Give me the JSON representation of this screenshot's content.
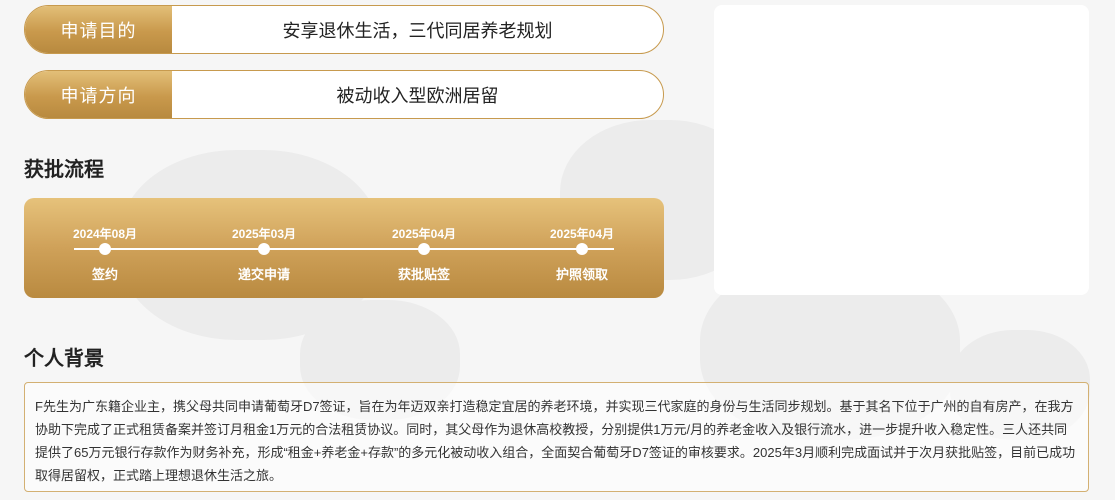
{
  "application": {
    "purpose_label": "申请目的",
    "purpose_value": "安享退休生活，三代同居养老规划",
    "direction_label": "申请方向",
    "direction_value": "被动收入型欧洲居留"
  },
  "process": {
    "title": "获批流程",
    "steps": [
      {
        "date": "2024年08月",
        "name": "签约"
      },
      {
        "date": "2025年03月",
        "name": "递交申请"
      },
      {
        "date": "2025年04月",
        "name": "获批贴签"
      },
      {
        "date": "2025年04月",
        "name": "护照领取"
      }
    ]
  },
  "background": {
    "title": "个人背景",
    "text": "F先生为广东籍企业主，携父母共同申请葡萄牙D7签证，旨在为年迈双亲打造稳定宜居的养老环境，并实现三代家庭的身份与生活同步规划。基于其名下位于广州的自有房产，在我方协助下完成了正式租赁备案并签订月租金1万元的合法租赁协议。同时，其父母作为退休高校教授，分别提供1万元/月的养老金收入及银行流水，进一步提升收入稳定性。三人还共同提供了65万元银行存款作为财务补充，形成“租金+养老金+存款”的多元化被动收入组合，全面契合葡萄牙D7签证的审核要求。2025年3月顺利完成面试并于次月获批贴签，目前已成功取得居留权，正式踏上理想退休生活之旅。"
  },
  "colors": {
    "gold_light": "#e3bf78",
    "gold_dark": "#b88a3f",
    "border_gold": "#c79a4e",
    "page_bg": "#f6f6f6"
  }
}
